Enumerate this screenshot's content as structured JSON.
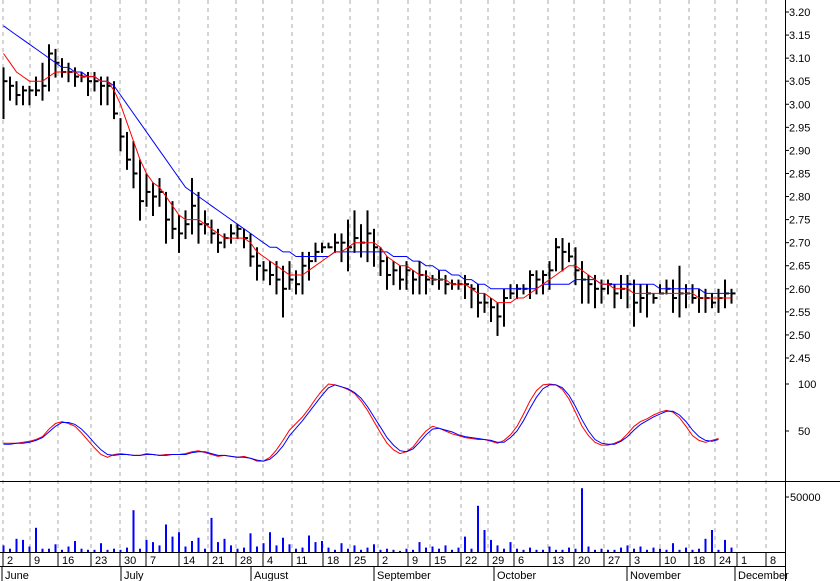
{
  "chart_data": [
    {
      "panel": "price",
      "type": "ohlc",
      "title": "",
      "ylim": [
        2.43,
        3.22
      ],
      "y_ticks": [
        "3.20",
        "3.15",
        "3.10",
        "3.05",
        "3.00",
        "2.95",
        "2.90",
        "2.85",
        "2.80",
        "2.75",
        "2.70",
        "2.65",
        "2.60",
        "2.55",
        "2.50",
        "2.45"
      ],
      "bars": [
        [
          2.97,
          3.08,
          3.05
        ],
        [
          3.01,
          3.06,
          3.04
        ],
        [
          3.0,
          3.05,
          3.02
        ],
        [
          3.0,
          3.04,
          3.03
        ],
        [
          3.0,
          3.04,
          3.03
        ],
        [
          3.02,
          3.06,
          3.03
        ],
        [
          3.01,
          3.09,
          3.04
        ],
        [
          3.03,
          3.13,
          3.11
        ],
        [
          3.06,
          3.12,
          3.09
        ],
        [
          3.06,
          3.1,
          3.07
        ],
        [
          3.05,
          3.09,
          3.07
        ],
        [
          3.04,
          3.08,
          3.06
        ],
        [
          3.05,
          3.07,
          3.06
        ],
        [
          3.02,
          3.07,
          3.05
        ],
        [
          3.03,
          3.07,
          3.05
        ],
        [
          3.0,
          3.06,
          3.04
        ],
        [
          3.0,
          3.06,
          3.04
        ],
        [
          2.97,
          3.05,
          2.98
        ],
        [
          2.9,
          2.97,
          2.93
        ],
        [
          2.86,
          2.94,
          2.88
        ],
        [
          2.82,
          2.92,
          2.85
        ],
        [
          2.75,
          2.88,
          2.79
        ],
        [
          2.78,
          2.85,
          2.81
        ],
        [
          2.76,
          2.83,
          2.8
        ],
        [
          2.78,
          2.84,
          2.81
        ],
        [
          2.7,
          2.81,
          2.75
        ],
        [
          2.71,
          2.79,
          2.73
        ],
        [
          2.68,
          2.76,
          2.72
        ],
        [
          2.71,
          2.77,
          2.74
        ],
        [
          2.72,
          2.84,
          2.78
        ],
        [
          2.7,
          2.81,
          2.74
        ],
        [
          2.72,
          2.77,
          2.74
        ],
        [
          2.7,
          2.75,
          2.72
        ],
        [
          2.68,
          2.73,
          2.7
        ],
        [
          2.69,
          2.72,
          2.71
        ],
        [
          2.7,
          2.74,
          2.72
        ],
        [
          2.71,
          2.74,
          2.73
        ],
        [
          2.69,
          2.73,
          2.71
        ],
        [
          2.65,
          2.72,
          2.67
        ],
        [
          2.62,
          2.69,
          2.65
        ],
        [
          2.62,
          2.66,
          2.64
        ],
        [
          2.61,
          2.66,
          2.63
        ],
        [
          2.59,
          2.66,
          2.62
        ],
        [
          2.54,
          2.65,
          2.6
        ],
        [
          2.6,
          2.66,
          2.62
        ],
        [
          2.59,
          2.64,
          2.61
        ],
        [
          2.59,
          2.68,
          2.65
        ],
        [
          2.62,
          2.68,
          2.66
        ],
        [
          2.66,
          2.7,
          2.68
        ],
        [
          2.68,
          2.7,
          2.69
        ],
        [
          2.69,
          2.7,
          2.69
        ],
        [
          2.68,
          2.72,
          2.7
        ],
        [
          2.66,
          2.72,
          2.7
        ],
        [
          2.64,
          2.75,
          2.69
        ],
        [
          2.68,
          2.77,
          2.71
        ],
        [
          2.67,
          2.74,
          2.7
        ],
        [
          2.66,
          2.77,
          2.72
        ],
        [
          2.65,
          2.73,
          2.69
        ],
        [
          2.63,
          2.69,
          2.66
        ],
        [
          2.6,
          2.67,
          2.63
        ],
        [
          2.61,
          2.66,
          2.64
        ],
        [
          2.6,
          2.65,
          2.62
        ],
        [
          2.6,
          2.66,
          2.64
        ],
        [
          2.59,
          2.64,
          2.62
        ],
        [
          2.59,
          2.66,
          2.63
        ],
        [
          2.59,
          2.64,
          2.62
        ],
        [
          2.61,
          2.63,
          2.62
        ],
        [
          2.6,
          2.64,
          2.62
        ],
        [
          2.59,
          2.63,
          2.61
        ],
        [
          2.6,
          2.62,
          2.61
        ],
        [
          2.6,
          2.62,
          2.61
        ],
        [
          2.58,
          2.63,
          2.61
        ],
        [
          2.56,
          2.61,
          2.6
        ],
        [
          2.54,
          2.61,
          2.57
        ],
        [
          2.55,
          2.59,
          2.57
        ],
        [
          2.53,
          2.58,
          2.56
        ],
        [
          2.5,
          2.57,
          2.54
        ],
        [
          2.52,
          2.6,
          2.58
        ],
        [
          2.58,
          2.61,
          2.59
        ],
        [
          2.58,
          2.61,
          2.6
        ],
        [
          2.59,
          2.61,
          2.6
        ],
        [
          2.58,
          2.64,
          2.63
        ],
        [
          2.59,
          2.64,
          2.62
        ],
        [
          2.59,
          2.64,
          2.63
        ],
        [
          2.6,
          2.66,
          2.64
        ],
        [
          2.64,
          2.71,
          2.69
        ],
        [
          2.64,
          2.71,
          2.68
        ],
        [
          2.66,
          2.7,
          2.67
        ],
        [
          2.61,
          2.69,
          2.64
        ],
        [
          2.57,
          2.66,
          2.62
        ],
        [
          2.57,
          2.63,
          2.61
        ],
        [
          2.56,
          2.63,
          2.6
        ],
        [
          2.57,
          2.62,
          2.6
        ],
        [
          2.59,
          2.62,
          2.61
        ],
        [
          2.56,
          2.61,
          2.59
        ],
        [
          2.58,
          2.63,
          2.6
        ],
        [
          2.56,
          2.63,
          2.61
        ],
        [
          2.52,
          2.62,
          2.57
        ],
        [
          2.55,
          2.61,
          2.58
        ],
        [
          2.54,
          2.61,
          2.59
        ],
        [
          2.57,
          2.59,
          2.58
        ],
        [
          2.59,
          2.61,
          2.59
        ],
        [
          2.59,
          2.62,
          2.6
        ],
        [
          2.55,
          2.62,
          2.58
        ],
        [
          2.54,
          2.65,
          2.59
        ],
        [
          2.56,
          2.61,
          2.59
        ],
        [
          2.57,
          2.61,
          2.58
        ],
        [
          2.55,
          2.6,
          2.58
        ],
        [
          2.55,
          2.6,
          2.58
        ],
        [
          2.56,
          2.59,
          2.57
        ],
        [
          2.55,
          2.6,
          2.58
        ],
        [
          2.56,
          2.62,
          2.59
        ],
        [
          2.57,
          2.6,
          2.59
        ]
      ],
      "ma_fast": [
        3.11,
        3.09,
        3.07,
        3.06,
        3.05,
        3.05,
        3.05,
        3.06,
        3.07,
        3.07,
        3.07,
        3.07,
        3.06,
        3.06,
        3.06,
        3.05,
        3.05,
        3.03,
        3.0,
        2.96,
        2.92,
        2.88,
        2.85,
        2.83,
        2.82,
        2.8,
        2.78,
        2.76,
        2.75,
        2.75,
        2.75,
        2.74,
        2.73,
        2.72,
        2.71,
        2.71,
        2.71,
        2.71,
        2.7,
        2.68,
        2.67,
        2.66,
        2.65,
        2.64,
        2.63,
        2.63,
        2.63,
        2.64,
        2.65,
        2.66,
        2.67,
        2.68,
        2.68,
        2.69,
        2.7,
        2.7,
        2.7,
        2.7,
        2.69,
        2.67,
        2.66,
        2.65,
        2.65,
        2.64,
        2.63,
        2.63,
        2.62,
        2.62,
        2.62,
        2.61,
        2.61,
        2.61,
        2.6,
        2.59,
        2.59,
        2.58,
        2.57,
        2.57,
        2.57,
        2.58,
        2.58,
        2.59,
        2.6,
        2.61,
        2.62,
        2.63,
        2.64,
        2.65,
        2.65,
        2.64,
        2.63,
        2.62,
        2.61,
        2.61,
        2.6,
        2.6,
        2.6,
        2.59,
        2.59,
        2.59,
        2.59,
        2.59,
        2.59,
        2.59,
        2.59,
        2.59,
        2.59,
        2.58,
        2.58,
        2.58,
        2.58,
        2.58,
        2.58
      ],
      "ma_slow": [
        3.17,
        3.16,
        3.15,
        3.14,
        3.13,
        3.12,
        3.11,
        3.1,
        3.09,
        3.08,
        3.08,
        3.07,
        3.07,
        3.06,
        3.06,
        3.05,
        3.05,
        3.04,
        3.02,
        3.0,
        2.98,
        2.96,
        2.94,
        2.92,
        2.9,
        2.88,
        2.86,
        2.84,
        2.82,
        2.81,
        2.8,
        2.79,
        2.78,
        2.77,
        2.76,
        2.75,
        2.74,
        2.73,
        2.72,
        2.71,
        2.7,
        2.69,
        2.69,
        2.68,
        2.68,
        2.67,
        2.67,
        2.67,
        2.67,
        2.67,
        2.67,
        2.68,
        2.68,
        2.68,
        2.68,
        2.68,
        2.68,
        2.68,
        2.68,
        2.68,
        2.67,
        2.67,
        2.67,
        2.66,
        2.66,
        2.65,
        2.65,
        2.64,
        2.64,
        2.63,
        2.63,
        2.62,
        2.62,
        2.61,
        2.61,
        2.6,
        2.6,
        2.6,
        2.6,
        2.6,
        2.6,
        2.6,
        2.6,
        2.61,
        2.61,
        2.61,
        2.61,
        2.61,
        2.62,
        2.62,
        2.62,
        2.62,
        2.61,
        2.61,
        2.61,
        2.61,
        2.61,
        2.61,
        2.61,
        2.61,
        2.61,
        2.6,
        2.6,
        2.6,
        2.6,
        2.6,
        2.6,
        2.6,
        2.59,
        2.59,
        2.59,
        2.59,
        2.59
      ],
      "colors": {
        "bars": "#000000",
        "ma_fast": "#ff0000",
        "ma_slow": "#0000ff",
        "grid": "#999999"
      }
    },
    {
      "panel": "stochastic",
      "type": "line",
      "ylim": [
        0,
        110
      ],
      "y_ticks": [
        "100",
        "50"
      ],
      "series": [
        {
          "color": "#ff0000",
          "values": [
            37,
            37,
            37,
            38,
            39,
            41,
            44,
            52,
            58,
            60,
            58,
            55,
            48,
            40,
            32,
            25,
            22,
            25,
            26,
            25,
            24,
            24,
            26,
            25,
            24,
            25,
            25,
            25,
            26,
            28,
            29,
            27,
            25,
            23,
            24,
            23,
            22,
            23,
            21,
            18,
            18,
            22,
            30,
            40,
            51,
            58,
            65,
            74,
            84,
            93,
            100,
            99,
            97,
            94,
            90,
            82,
            72,
            60,
            48,
            37,
            30,
            26,
            28,
            33,
            42,
            50,
            55,
            53,
            50,
            47,
            45,
            43,
            42,
            41,
            41,
            39,
            37,
            40,
            46,
            55,
            68,
            82,
            93,
            99,
            100,
            99,
            94,
            84,
            70,
            55,
            45,
            38,
            35,
            35,
            37,
            40,
            47,
            55,
            60,
            63,
            67,
            70,
            72,
            70,
            64,
            55,
            45,
            40,
            38,
            40,
            42
          ]
        },
        {
          "color": "#0000ff",
          "values": [
            36,
            36,
            37,
            37,
            38,
            40,
            43,
            49,
            55,
            59,
            59,
            57,
            52,
            45,
            37,
            30,
            25,
            24,
            25,
            25,
            24,
            24,
            25,
            25,
            24,
            24,
            25,
            25,
            25,
            27,
            28,
            28,
            26,
            24,
            24,
            23,
            22,
            22,
            21,
            19,
            18,
            20,
            26,
            34,
            45,
            53,
            61,
            70,
            79,
            88,
            96,
            99,
            97,
            95,
            91,
            85,
            76,
            65,
            54,
            43,
            35,
            29,
            28,
            31,
            38,
            46,
            52,
            53,
            51,
            49,
            46,
            44,
            43,
            42,
            41,
            40,
            38,
            38,
            43,
            50,
            61,
            74,
            86,
            95,
            99,
            99,
            96,
            88,
            76,
            62,
            50,
            41,
            37,
            36,
            36,
            39,
            44,
            51,
            57,
            61,
            65,
            68,
            71,
            71,
            67,
            60,
            51,
            44,
            40,
            39,
            41
          ]
        }
      ]
    },
    {
      "panel": "volume",
      "type": "bar",
      "ylim": [
        0,
        60000
      ],
      "y_ticks": [
        "50000"
      ],
      "color": "#0000ff",
      "values": [
        6000,
        3000,
        12000,
        11000,
        5000,
        22000,
        3000,
        3000,
        7000,
        2000,
        5000,
        10000,
        3000,
        2000,
        2000,
        8000,
        2000,
        3000,
        2000,
        4000,
        38000,
        3000,
        11000,
        9000,
        6000,
        25000,
        14000,
        18000,
        5000,
        10000,
        13000,
        3000,
        31000,
        9000,
        12000,
        6000,
        3000,
        4000,
        17000,
        5000,
        8000,
        18000,
        6000,
        13000,
        7000,
        3000,
        4000,
        15000,
        9000,
        10000,
        4000,
        2000,
        8000,
        3000,
        6000,
        2000,
        4000,
        7000,
        2000,
        3000,
        2000,
        1000,
        3000,
        2000,
        9000,
        4000,
        5000,
        3000,
        6000,
        2000,
        4000,
        14000,
        3000,
        42000,
        20000,
        11000,
        6000,
        3000,
        9000,
        3000,
        2000,
        4000,
        2000,
        2000,
        5000,
        2000,
        2000,
        4000,
        3000,
        58000,
        5000,
        2000,
        3000,
        2000,
        2000,
        4000,
        6000,
        3000,
        5000,
        2000,
        4000,
        3000,
        2000,
        8000,
        2000,
        4000,
        2000,
        3000,
        12000,
        20000,
        2000,
        11000,
        4000
      ]
    }
  ],
  "x_axis": {
    "day_labels": [
      "2",
      "9",
      "16",
      "23",
      "30",
      "7",
      "14",
      "21",
      "28",
      "4",
      "11",
      "18",
      "25",
      "2",
      "9",
      "15",
      "22",
      "29",
      "6",
      "13",
      "20",
      "27",
      "3",
      "10",
      "18",
      "24",
      "1",
      "8"
    ],
    "month_labels": [
      "June",
      "July",
      "August",
      "September",
      "October",
      "November",
      "December"
    ]
  }
}
